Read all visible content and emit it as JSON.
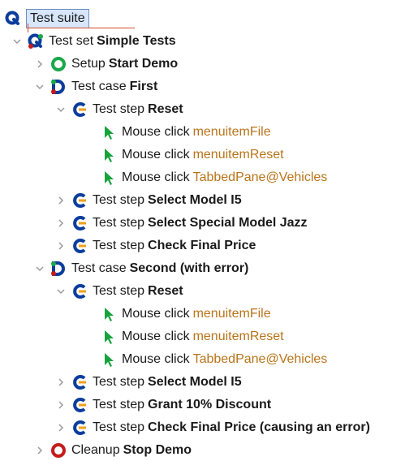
{
  "tree": {
    "root": {
      "label": "Test suite"
    },
    "set": {
      "prefix": "Test set",
      "name": "Simple Tests"
    },
    "setup": {
      "prefix": "Setup",
      "name": "Start Demo"
    },
    "case1": {
      "prefix": "Test case",
      "name": "First",
      "step_reset": {
        "prefix": "Test step",
        "name": "Reset"
      },
      "clicks": [
        {
          "prefix": "Mouse click",
          "target": "menuitemFile"
        },
        {
          "prefix": "Mouse click",
          "target": "menuitemReset"
        },
        {
          "prefix": "Mouse click",
          "target": "TabbedPane@Vehicles"
        }
      ],
      "steps": [
        {
          "prefix": "Test step",
          "name": "Select Model I5"
        },
        {
          "prefix": "Test step",
          "name": "Select Special Model Jazz"
        },
        {
          "prefix": "Test step",
          "name": "Check Final Price"
        }
      ]
    },
    "case2": {
      "prefix": "Test case",
      "name": "Second (with error)",
      "step_reset": {
        "prefix": "Test step",
        "name": "Reset"
      },
      "clicks": [
        {
          "prefix": "Mouse click",
          "target": "menuitemFile"
        },
        {
          "prefix": "Mouse click",
          "target": "menuitemReset"
        },
        {
          "prefix": "Mouse click",
          "target": "TabbedPane@Vehicles"
        }
      ],
      "steps": [
        {
          "prefix": "Test step",
          "name": "Select Model I5"
        },
        {
          "prefix": "Test step",
          "name": "Grant 10% Discount"
        },
        {
          "prefix": "Test step",
          "name": "Check Final Price (causing an error)"
        }
      ]
    },
    "cleanup": {
      "prefix": "Cleanup",
      "name": "Stop Demo"
    }
  },
  "icons": {
    "suite": "test-suite-icon",
    "set": "test-set-icon",
    "setup": "setup-icon",
    "case": "test-case-icon",
    "step": "test-step-icon",
    "click": "mouse-click-icon",
    "cleanup": "cleanup-icon"
  },
  "colors": {
    "selection_bg": "#d7e6fb",
    "selection_border": "#6d8fbf",
    "argument_text": "#b8741a",
    "setup_green": "#19a84a",
    "cleanup_red": "#c41b1b",
    "node_blue": "#0b3d9c"
  }
}
